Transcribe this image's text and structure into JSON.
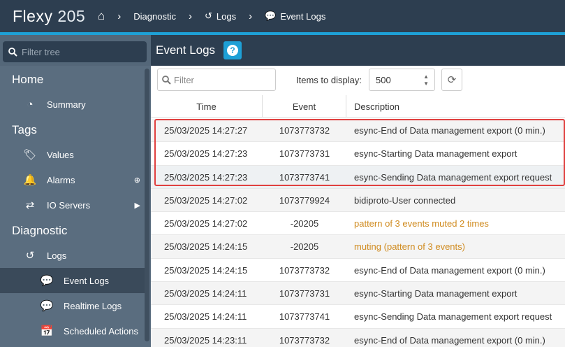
{
  "header": {
    "brand_name": "Flexy",
    "brand_model": "205",
    "breadcrumb": [
      "Diagnostic",
      "Logs",
      "Event Logs"
    ]
  },
  "sidebar": {
    "filter_placeholder": "Filter tree",
    "sections": {
      "home": "Home",
      "tags": "Tags",
      "diagnostic": "Diagnostic"
    },
    "items": {
      "summary": "Summary",
      "values": "Values",
      "alarms": "Alarms",
      "io_servers": "IO Servers",
      "logs": "Logs",
      "event_logs": "Event Logs",
      "realtime_logs": "Realtime Logs",
      "scheduled_actions": "Scheduled Actions"
    }
  },
  "content": {
    "title": "Event Logs",
    "filter_placeholder": "Filter",
    "items_label": "Items to display:",
    "items_value": "500",
    "columns": {
      "time": "Time",
      "event": "Event",
      "description": "Description"
    },
    "rows": [
      {
        "time": "25/03/2025 14:27:27",
        "event": "1073773732",
        "description": "esync-End of Data management export (0 min.)"
      },
      {
        "time": "25/03/2025 14:27:23",
        "event": "1073773731",
        "description": "esync-Starting Data management export"
      },
      {
        "time": "25/03/2025 14:27:23",
        "event": "1073773741",
        "description": "esync-Sending Data management export request"
      },
      {
        "time": "25/03/2025 14:27:02",
        "event": "1073779924",
        "description": "bidiproto-User connected"
      },
      {
        "time": "25/03/2025 14:27:02",
        "event": "-20205",
        "description": "pattern of 3 events muted 2 times"
      },
      {
        "time": "25/03/2025 14:24:15",
        "event": "-20205",
        "description": "muting (pattern of 3 events)"
      },
      {
        "time": "25/03/2025 14:24:15",
        "event": "1073773732",
        "description": "esync-End of Data management export (0 min.)"
      },
      {
        "time": "25/03/2025 14:24:11",
        "event": "1073773731",
        "description": "esync-Starting Data management export"
      },
      {
        "time": "25/03/2025 14:24:11",
        "event": "1073773741",
        "description": "esync-Sending Data management export request"
      },
      {
        "time": "25/03/2025 14:23:11",
        "event": "1073773732",
        "description": "esync-End of Data management export (0 min.)"
      }
    ]
  },
  "colors": {
    "topbar": "#2d3e50",
    "accent": "#1ea0d6",
    "sidebar": "#5a6d7f",
    "warning_text": "#d08b1f",
    "highlight_box": "#e0403f"
  }
}
